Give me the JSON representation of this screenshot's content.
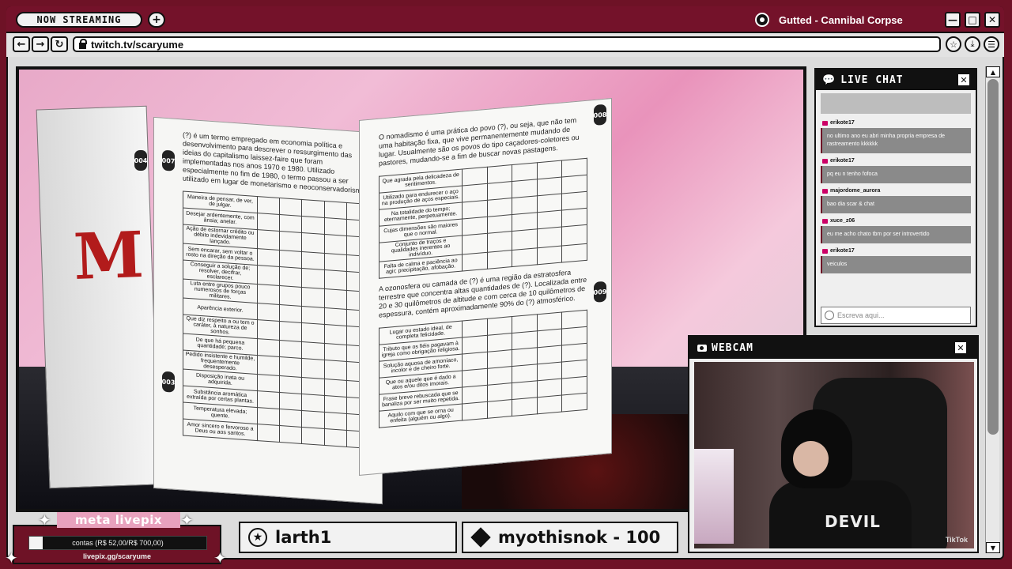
{
  "titlebar": {
    "badge": "NOW STREAMING",
    "add_label": "+",
    "now_playing": "Gutted - Cannibal Corpse",
    "min_label": "—",
    "max_label": "□",
    "close_label": "✕"
  },
  "navbar": {
    "back": "←",
    "forward": "→",
    "reload": "↻",
    "url": "twitch.tv/scaryume",
    "star": "☆",
    "download": "⤓",
    "menu": "☰"
  },
  "book": {
    "left_page_text": "(?) é um termo empregado em economia política e desenvolvimento para descrever o ressurgimento das ideias do capitalismo laissez-faire que foram implementadas nos anos 1970 e 1980. Utilizado especialmente no fim de 1980, o termo passou a ser utilizado em lugar de monetarismo e neoconservadorismo.",
    "right_page_text": "O nomadismo é uma prática do povo (?), ou seja, que não tem uma habitação fixa, que vive permanentemente mudando de lugar. Usualmente são os povos do tipo caçadores-coletores ou pastores, mudando-se a fim de buscar novas pastagens.",
    "left_rows": [
      "Maneira de pensar, de ver, de julgar.",
      "Desejar ardentemente, com ânsia; anelar.",
      "Ação de estornar crédito ou débito indevidamente lançado.",
      "Sem encarar, sem voltar o rosto na direção da pessoa.",
      "Conseguir a solução de; resolver, decifrar, esclarecer.",
      "Luta entre grupos pouco numerosos de forças militares.",
      "Aparência exterior.",
      "Que diz respeito a ou tem o caráter, à natureza de sonhos.",
      "De que há pequena quantidade; parco.",
      "Pedido insistente e humilde, frequentemente desesperado.",
      "Disposição inata ou adquirida.",
      "Substância aromática extraída por certas plantas.",
      "Temperatura elevada; quente.",
      "Amor sincero e fervoroso a Deus ou aos santos."
    ],
    "right_rows_top": [
      "Que agrada pela delicadeza de sentimentos.",
      "Utilizado para endurecer o aço na produção de aços especiais.",
      "Na totalidade do tempo; eternamente, perpetuamente.",
      "Cujas dimensões são maiores que o normal.",
      "Conjunto de traços e qualidades inerentes ao indivíduo.",
      "Falta de calma e paciência ao agir; precipitação, afobação."
    ],
    "right_mid_text": "A ozonosfera ou camada de (?) é uma região da estratosfera terrestre que concentra altas quantidades de (?). Localizada entre 20 e 30 quilômetros de altitude e com cerca de 10 quilômetros de espessura, contém aproximadamente 90% do (?) atmosférico.",
    "right_rows_bottom": [
      "Lugar ou estado ideal, de completa felicidade.",
      "Tributo que os fiéis pagavam à igreja como obrigação religiosa.",
      "Solução aquosa de amoníaco, incolor e de cheiro forte.",
      "Que ou aquele que é dado a atos e/ou ditos imorais.",
      "Frase breve rebuscada que se banaliza por ser muito repetida.",
      "Aquilo com que se orna ou enfeita (alguém ou algo)."
    ],
    "page_nums": [
      "004",
      "007",
      "003",
      "008",
      "009"
    ],
    "cover_title": "M"
  },
  "chat": {
    "title": "LIVE CHAT",
    "close_label": "✕",
    "messages": [
      {
        "user": "erikote17",
        "text": "no ultimo ano eu abri minha propria empresa de rastreamento kkkkkk"
      },
      {
        "user": "erikote17",
        "text": "pq eu n tenho fofoca"
      },
      {
        "user": "majordome_aurora",
        "text": "bao dia scar & chat"
      },
      {
        "user": "xuce_z06",
        "text": "eu me acho chato tbm por ser introvertido"
      },
      {
        "user": "erikote17",
        "text": "veiculos"
      }
    ],
    "input_placeholder": "Escreva aqui..."
  },
  "webcam": {
    "title": "WEBCAM",
    "close_label": "✕",
    "shirt_text": "DEVIL",
    "watermark": "TikTok"
  },
  "goal": {
    "title": "meta livepix",
    "progress_text": "contas (R$ 52,00/R$ 700,00)",
    "progress": 0.074,
    "url": "livepix.gg/scaryume"
  },
  "alerts": {
    "follower": "larth1",
    "sub": "myothisnok - 100"
  },
  "colors": {
    "frame": "#6e1226",
    "chrome": "#dcdcdc",
    "accent_pink": "#e8a1bd"
  }
}
